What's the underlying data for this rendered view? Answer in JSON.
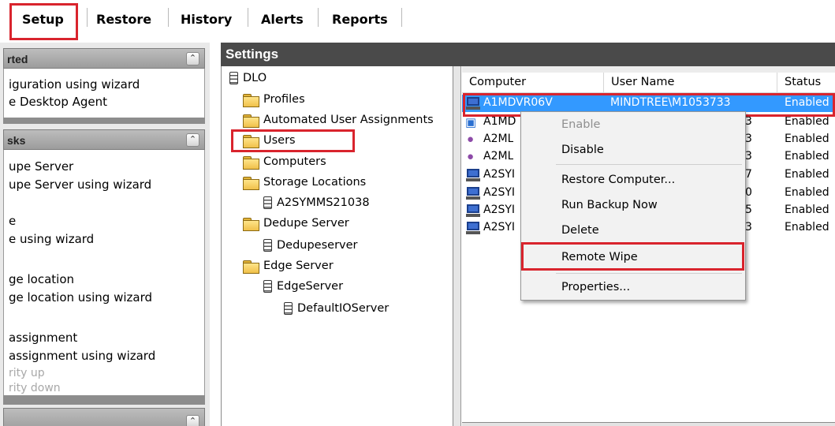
{
  "toolbar": {
    "tabs": [
      "Setup",
      "Restore",
      "History",
      "Alerts",
      "Reports"
    ],
    "active_tab": "Setup"
  },
  "left_panels": [
    {
      "header": "rted",
      "lines": [
        {
          "text": "iguration using wizard",
          "enabled": true
        },
        {
          "text": "e Desktop Agent",
          "enabled": true
        }
      ]
    },
    {
      "header": "sks",
      "lines": [
        {
          "text": "upe Server",
          "enabled": true
        },
        {
          "text": "upe Server using wizard",
          "enabled": true
        },
        {
          "text": "e",
          "enabled": true
        },
        {
          "text": "e using wizard",
          "enabled": true
        },
        {
          "text": "ge location",
          "enabled": true
        },
        {
          "text": "ge location using wizard",
          "enabled": true
        },
        {
          "text": "assignment",
          "enabled": true
        },
        {
          "text": "assignment using wizard",
          "enabled": true
        },
        {
          "text": "rity up",
          "enabled": false
        },
        {
          "text": "rity down",
          "enabled": false
        }
      ]
    }
  ],
  "settings": {
    "title": "Settings",
    "tree": [
      {
        "label": "DLO",
        "icon": "server-icon"
      },
      {
        "label": "Profiles",
        "icon": "folder-icon"
      },
      {
        "label": "Automated User Assignments",
        "icon": "folder-icon"
      },
      {
        "label": "Users",
        "icon": "folder-icon"
      },
      {
        "label": "Computers",
        "icon": "folder-open-icon"
      },
      {
        "label": "Storage Locations",
        "icon": "folder-icon"
      },
      {
        "label": "A2SYMMS21038",
        "icon": "server-icon"
      },
      {
        "label": "Dedupe Server",
        "icon": "folder-icon"
      },
      {
        "label": "Dedupeserver",
        "icon": "server-icon"
      },
      {
        "label": "Edge Server",
        "icon": "folder-icon"
      },
      {
        "label": "EdgeServer",
        "icon": "server-icon"
      },
      {
        "label": "DefaultIOServer",
        "icon": "server-icon"
      }
    ],
    "selected_tree_item": "Computers"
  },
  "list": {
    "columns": [
      "Computer",
      "User Name",
      "Status"
    ],
    "rows": [
      {
        "computer": "A1MDVR06V",
        "user": "MINDTREE\\M1053733",
        "status": "Enabled",
        "icon": "computer-icon"
      },
      {
        "computer": "A1MD",
        "user": "3",
        "status": "Enabled",
        "icon": "network-computer-icon"
      },
      {
        "computer": "A2ML",
        "user": "3",
        "status": "Enabled",
        "icon": "mac-icon"
      },
      {
        "computer": "A2ML",
        "user": "3",
        "status": "Enabled",
        "icon": "mac-icon"
      },
      {
        "computer": "A2SYI",
        "user": "7",
        "status": "Enabled",
        "icon": "computer-icon"
      },
      {
        "computer": "A2SYI",
        "user": "0",
        "status": "Enabled",
        "icon": "computer-icon"
      },
      {
        "computer": "A2SYI",
        "user": "5",
        "status": "Enabled",
        "icon": "computer-icon"
      },
      {
        "computer": "A2SYI",
        "user": "3",
        "status": "Enabled",
        "icon": "computer-icon"
      }
    ],
    "selected_row": 0
  },
  "context_menu": {
    "items": [
      {
        "label": "Enable",
        "enabled": false
      },
      {
        "label": "Disable",
        "enabled": true
      },
      {
        "label": "Restore Computer...",
        "enabled": true
      },
      {
        "label": "Run Backup Now",
        "enabled": true
      },
      {
        "label": "Delete",
        "enabled": true
      },
      {
        "label": "Remote Wipe",
        "enabled": true
      },
      {
        "label": "Properties...",
        "enabled": true
      }
    ],
    "highlighted": "Remote Wipe"
  },
  "colors": {
    "highlight_red": "#d9242d",
    "selection_blue": "#3399ff",
    "settings_header": "#4a4a4a"
  }
}
